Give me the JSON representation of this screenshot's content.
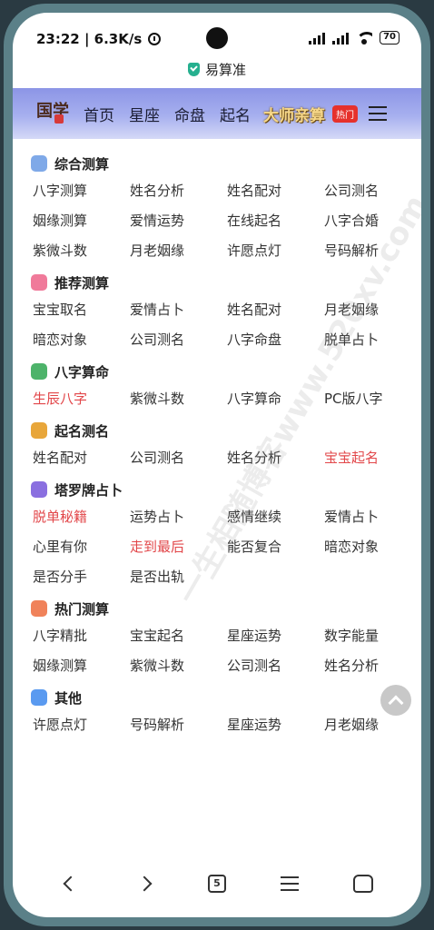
{
  "status": {
    "time_speed": "23:22 | 6.3K/s",
    "battery": "70"
  },
  "urlbar": {
    "title": "易算准"
  },
  "nav": {
    "logo_text": "国学",
    "links": [
      "首页",
      "星座",
      "命盘",
      "起名"
    ],
    "master": "大师亲算",
    "hot": "热门"
  },
  "sections": [
    {
      "title": "综合测算",
      "color": "#7fa9e8",
      "items": [
        [
          "八字测算",
          ""
        ],
        [
          "姓名分析",
          ""
        ],
        [
          "姓名配对",
          ""
        ],
        [
          "公司测名",
          ""
        ],
        [
          "姻缘测算",
          ""
        ],
        [
          "爱情运势",
          ""
        ],
        [
          "在线起名",
          ""
        ],
        [
          "八字合婚",
          ""
        ],
        [
          "紫微斗数",
          ""
        ],
        [
          "月老姻缘",
          ""
        ],
        [
          "许愿点灯",
          ""
        ],
        [
          "号码解析",
          ""
        ]
      ]
    },
    {
      "title": "推荐测算",
      "color": "#f07a9a",
      "items": [
        [
          "宝宝取名",
          ""
        ],
        [
          "爱情占卜",
          ""
        ],
        [
          "姓名配对",
          ""
        ],
        [
          "月老姻缘",
          ""
        ],
        [
          "暗恋对象",
          ""
        ],
        [
          "公司测名",
          ""
        ],
        [
          "八字命盘",
          ""
        ],
        [
          "脱单占卜",
          ""
        ]
      ]
    },
    {
      "title": "八字算命",
      "color": "#4db36a",
      "items": [
        [
          "生辰八字",
          "red"
        ],
        [
          "紫微斗数",
          ""
        ],
        [
          "八字算命",
          ""
        ],
        [
          "PC版八字",
          ""
        ]
      ]
    },
    {
      "title": "起名测名",
      "color": "#e8a63a",
      "items": [
        [
          "姓名配对",
          ""
        ],
        [
          "公司测名",
          ""
        ],
        [
          "姓名分析",
          ""
        ],
        [
          "宝宝起名",
          "red"
        ]
      ]
    },
    {
      "title": "塔罗牌占卜",
      "color": "#8a6fe0",
      "items": [
        [
          "脱单秘籍",
          "red"
        ],
        [
          "运势占卜",
          ""
        ],
        [
          "感情继续",
          ""
        ],
        [
          "爱情占卜",
          ""
        ],
        [
          "心里有你",
          ""
        ],
        [
          "走到最后",
          "red"
        ],
        [
          "能否复合",
          ""
        ],
        [
          "暗恋对象",
          ""
        ],
        [
          "是否分手",
          ""
        ],
        [
          "是否出轨",
          ""
        ]
      ]
    },
    {
      "title": "热门测算",
      "color": "#f0825a",
      "items": [
        [
          "八字精批",
          ""
        ],
        [
          "宝宝起名",
          ""
        ],
        [
          "星座运势",
          ""
        ],
        [
          "数字能量",
          ""
        ],
        [
          "姻缘测算",
          ""
        ],
        [
          "紫微斗数",
          ""
        ],
        [
          "公司测名",
          ""
        ],
        [
          "姓名分析",
          ""
        ]
      ]
    },
    {
      "title": "其他",
      "color": "#5a9af0",
      "items": [
        [
          "许愿点灯",
          ""
        ],
        [
          "号码解析",
          ""
        ],
        [
          "星座运势",
          ""
        ],
        [
          "月老姻缘",
          ""
        ]
      ]
    }
  ],
  "bottom": {
    "tab_count": "5"
  },
  "watermark": "一生相随博客www.520xv.com"
}
